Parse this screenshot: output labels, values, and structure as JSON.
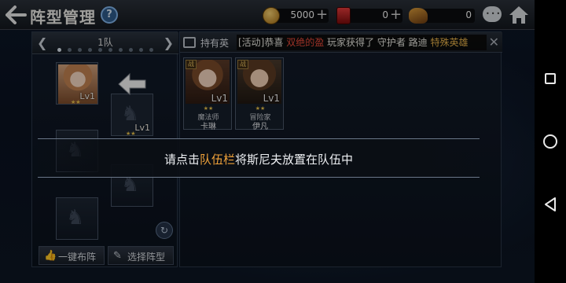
{
  "header": {
    "title": "阵型管理",
    "help": "?"
  },
  "resources": [
    {
      "icon": "gold-coin-icon",
      "value": "5000"
    },
    {
      "icon": "red-gem-icon",
      "value": "0"
    },
    {
      "icon": "ore-icon",
      "value": "0"
    }
  ],
  "team": {
    "label": "1队",
    "slots": [
      {
        "type": "hero",
        "level": "Lv1",
        "icon": "hero-portrait"
      },
      {
        "type": "hero",
        "level": "Lv1",
        "icon": "hero-portrait"
      },
      {
        "type": "empty"
      },
      {
        "type": "empty"
      },
      {
        "type": "empty"
      }
    ]
  },
  "buttons": {
    "auto_formation": "一键布阵",
    "select_formation": "选择阵型"
  },
  "owned": {
    "title": "持有英",
    "marquee": {
      "part1": "[活动]恭喜 ",
      "part2": "双绝的盈",
      "part3": " 玩家获得了 守护者 路迪 ",
      "part4": "特殊英雄"
    },
    "heroes": [
      {
        "class": "魔法师",
        "name": "卡琳",
        "level": "Lv1",
        "badge": "战"
      },
      {
        "class": "冒险家",
        "name": "伊凡",
        "level": "Lv1",
        "badge": "战"
      }
    ]
  },
  "tutorial": {
    "before": "请点击",
    "highlight": "队伍栏",
    "after": "将斯尼夫放置在队伍中"
  },
  "colors": {
    "highlight": "#f0a23a",
    "marquee_red": "#e84b3a",
    "marquee_gold": "#e7b24a"
  }
}
